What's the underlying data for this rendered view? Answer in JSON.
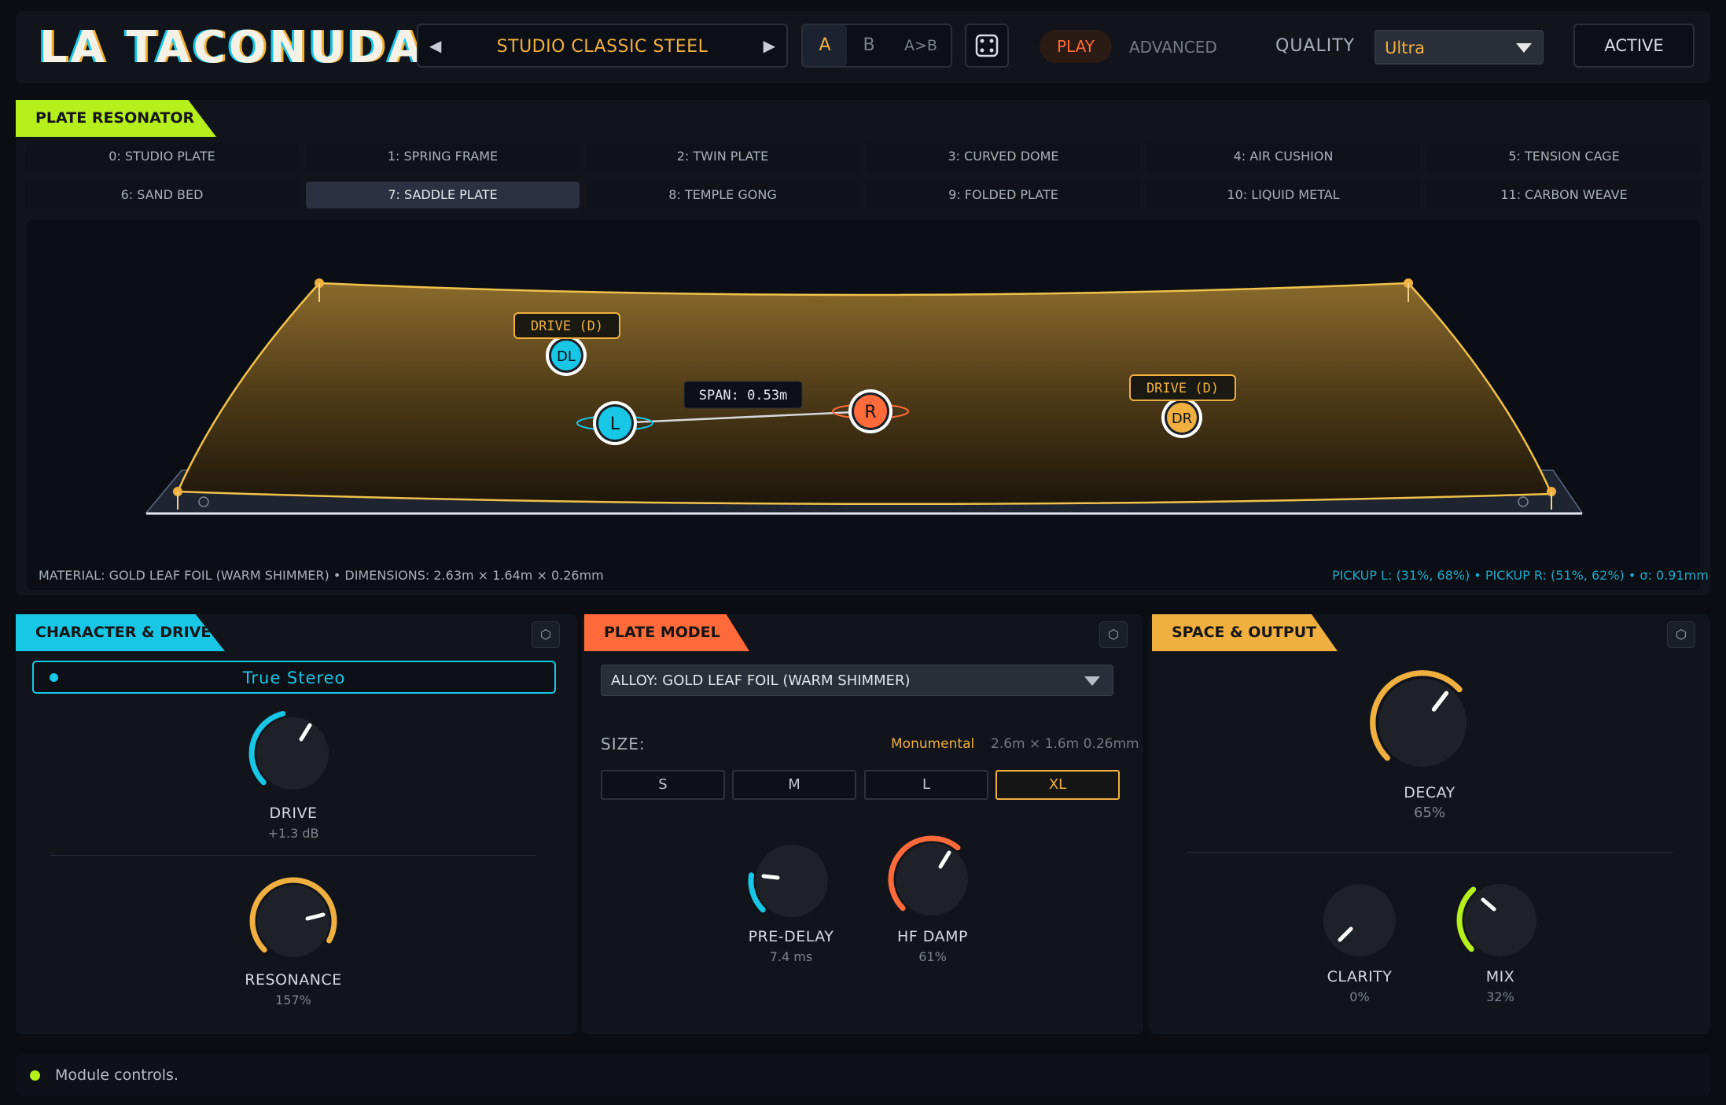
{
  "header": {
    "logo": "LA TACONUDA",
    "preset_name": "STUDIO CLASSIC STEEL",
    "ab": {
      "a": "A",
      "b": "B",
      "a_to_b": "A>B"
    },
    "mode_play": "PLAY",
    "mode_advanced": "ADVANCED",
    "quality_label": "QUALITY",
    "quality_value": "Ultra",
    "active_label": "ACTIVE"
  },
  "resonator": {
    "tag": "PLATE RESONATOR",
    "plates_row1": [
      "0: STUDIO PLATE",
      "1: SPRING FRAME",
      "2: TWIN PLATE",
      "3: CURVED DOME",
      "4: AIR CUSHION",
      "5: TENSION CAGE"
    ],
    "plates_row2": [
      "6: SAND BED",
      "7: SADDLE PLATE",
      "8: TEMPLE GONG",
      "9: FOLDED PLATE",
      "10: LIQUID METAL",
      "11: CARBON WEAVE"
    ],
    "selected_plate": "7: SADDLE PLATE",
    "drive_left_label": "DRIVE (D)",
    "drive_right_label": "DRIVE (D)",
    "node_dl": "DL",
    "node_dr": "DR",
    "node_l": "L",
    "node_r": "R",
    "span_label": "SPAN: 0.53m",
    "footer_left": "MATERIAL: GOLD LEAF FOIL (WARM SHIMMER)  •  DIMENSIONS: 2.63m × 1.64m × 0.26mm",
    "footer_right": "PICKUP L: (31%, 68%)  •  PICKUP R: (51%, 62%)  •  σ: 0.91mm"
  },
  "character": {
    "tag": "CHARACTER & DRIVE",
    "stereo_mode": "True Stereo",
    "drive_label": "DRIVE",
    "drive_value": "+1.3 dB",
    "resonance_label": "RESONANCE",
    "resonance_value": "157%"
  },
  "plate_model": {
    "tag": "PLATE MODEL",
    "alloy": "ALLOY: GOLD LEAF FOIL (WARM SHIMMER)",
    "size_label": "SIZE:",
    "size_tier": "Monumental",
    "size_dims": "2.6m × 1.6m  0.26mm",
    "sizes": [
      "S",
      "M",
      "L",
      "XL"
    ],
    "selected_size": "XL",
    "predelay_label": "PRE-DELAY",
    "predelay_value": "7.4 ms",
    "hfdamp_label": "HF DAMP",
    "hfdamp_value": "61%"
  },
  "space": {
    "tag": "SPACE & OUTPUT",
    "decay_label": "DECAY",
    "decay_value": "65%",
    "clarity_label": "CLARITY",
    "clarity_value": "0%",
    "mix_label": "MIX",
    "mix_value": "32%"
  },
  "status": {
    "text": "Module controls."
  },
  "colors": {
    "cyan": "#18c6e6",
    "orange": "#ff6a3a",
    "gold": "#f0b040",
    "lime": "#b5f01c"
  },
  "knob_levels": {
    "drive": 0.55,
    "resonance": 0.7,
    "predelay": 0.2,
    "hfdamp": 0.61,
    "decay": 0.65,
    "clarity": 0.0,
    "mix": 0.32
  }
}
